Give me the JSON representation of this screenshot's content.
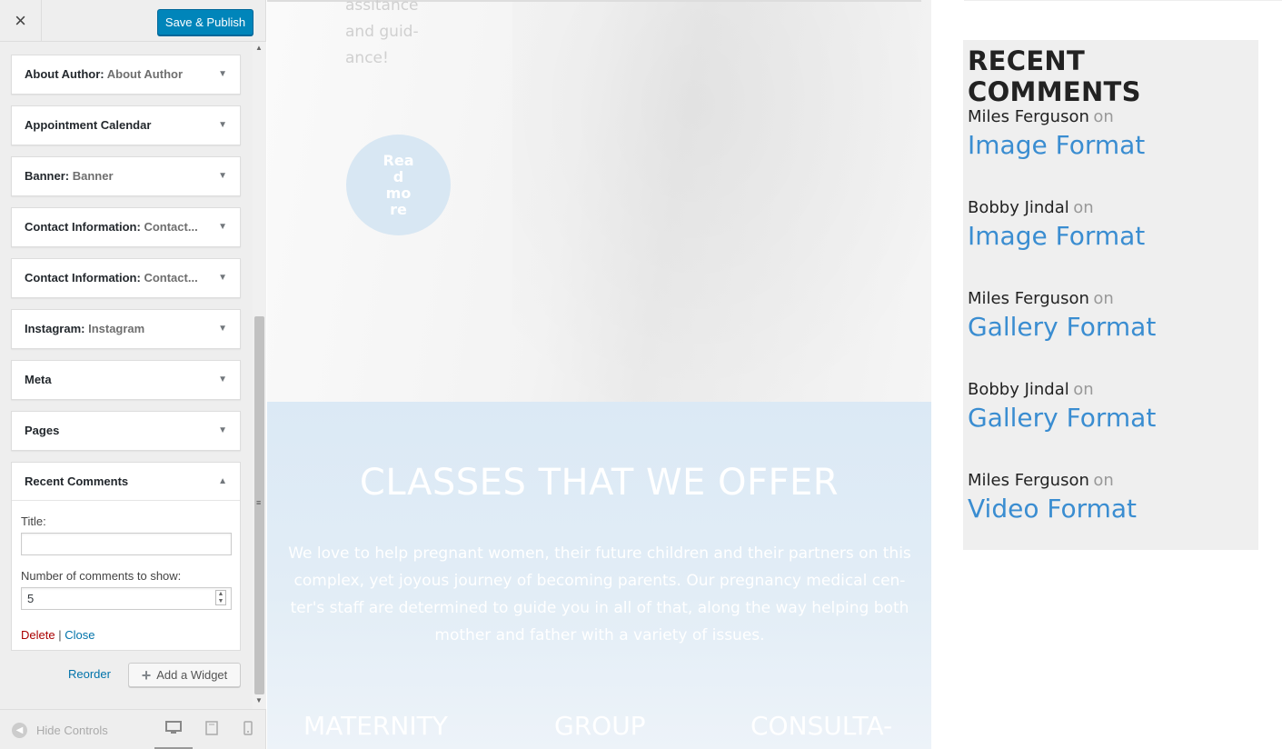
{
  "panel": {
    "close_glyph": "×",
    "publish_label": "Save & Publish",
    "widgets": [
      {
        "title": "About Author",
        "sub": "About Author"
      },
      {
        "title": "Appointment Calendar",
        "sub": ""
      },
      {
        "title": "Banner",
        "sub": "Banner"
      },
      {
        "title": "Contact Information",
        "sub": "Contact..."
      },
      {
        "title": "Contact Information",
        "sub": "Contact..."
      },
      {
        "title": "Instagram",
        "sub": "Instagram"
      },
      {
        "title": "Meta",
        "sub": ""
      },
      {
        "title": "Pages",
        "sub": ""
      }
    ],
    "expanded_widget": {
      "title": "Recent Comments",
      "title_field_label": "Title:",
      "title_field_value": "",
      "count_field_label": "Number of comments to show:",
      "count_field_value": "5",
      "delete_label": "Delete",
      "separator": "|",
      "close_label": "Close"
    },
    "reorder_label": "Reorder",
    "add_widget_label": "Add a Widget",
    "hide_controls_label": "Hide Controls",
    "icons": {
      "collapse_arrow": "▼",
      "expand_arrow": "▲",
      "plus": "+",
      "hide": "◀",
      "desktop": "desktop-icon",
      "tablet": "tablet-icon",
      "mobile": "mobile-icon"
    }
  },
  "preview": {
    "hero_text": "assitance and guid-ance!",
    "read_more": "Rea d mo re",
    "classes_title": "CLASSES THAT WE OFFER",
    "classes_desc": "We love to help pregnant women, their future children and their partners on this complex, yet joyous journey of becoming parents. Our pregnancy medical cen-ter's staff are determined to guide you in all of that, along the way helping both mother and father with a variety of issues.",
    "services": [
      "MATERNITY",
      "GROUP",
      "CONSULTA-"
    ],
    "recent_comments": {
      "title": "RECENT COMMENTS",
      "on_word": "on",
      "items": [
        {
          "author": "Miles Ferguson",
          "post": "Image Format"
        },
        {
          "author": "Bobby Jindal",
          "post": "Image Format"
        },
        {
          "author": "Miles Ferguson",
          "post": "Gallery Format"
        },
        {
          "author": "Bobby Jindal",
          "post": "Gallery Format"
        },
        {
          "author": "Miles Ferguson",
          "post": "Video Format"
        }
      ]
    }
  },
  "colors": {
    "primary_button": "#0085ba",
    "link_blue": "#0073aa",
    "delete_red": "#a00",
    "post_link": "#3a8dd1"
  }
}
